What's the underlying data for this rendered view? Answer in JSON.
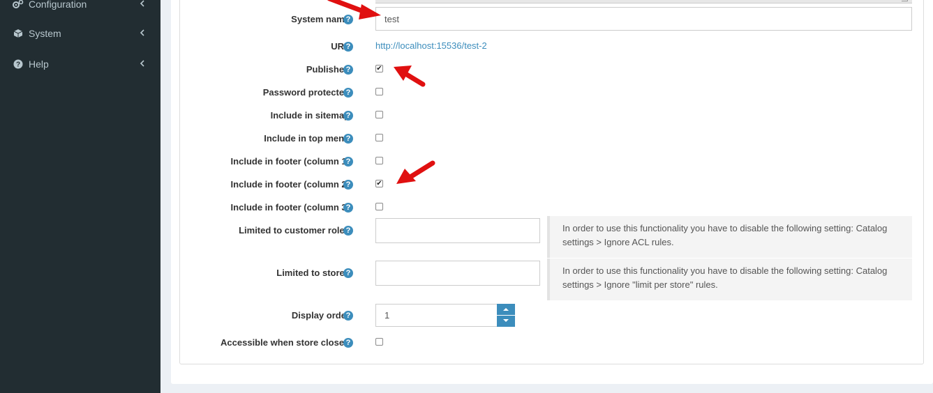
{
  "sidebar": {
    "items": [
      {
        "label": "Configuration",
        "icon": "gears-icon"
      },
      {
        "label": "System",
        "icon": "cube-icon"
      },
      {
        "label": "Help",
        "icon": "question-circle-icon"
      }
    ]
  },
  "form": {
    "system_name": {
      "label": "System name",
      "value": "test"
    },
    "url": {
      "label": "URL",
      "value": "http://localhost:15536/test-2"
    },
    "published": {
      "label": "Published",
      "checked": true
    },
    "password_protected": {
      "label": "Password protected",
      "checked": false
    },
    "include_in_sitemap": {
      "label": "Include in sitemap",
      "checked": false
    },
    "include_in_top_menu": {
      "label": "Include in top menu",
      "checked": false
    },
    "include_in_footer_1": {
      "label": "Include in footer (column 1)",
      "checked": false
    },
    "include_in_footer_2": {
      "label": "Include in footer (column 2)",
      "checked": true
    },
    "include_in_footer_3": {
      "label": "Include in footer (column 3)",
      "checked": false
    },
    "limited_to_customer_roles": {
      "label": "Limited to customer roles",
      "value": "",
      "note": "In order to use this functionality you have to disable the following setting: Catalog settings > Ignore ACL rules."
    },
    "limited_to_stores": {
      "label": "Limited to stores",
      "value": "",
      "note": "In order to use this functionality you have to disable the following setting: Catalog settings > Ignore \"limit per store\" rules."
    },
    "display_order": {
      "label": "Display order",
      "value": "1"
    },
    "accessible_when_store_closed": {
      "label": "Accessible when store closed",
      "checked": false
    }
  },
  "colors": {
    "sidebar_bg": "#222d32",
    "accent": "#3c8dbc",
    "annotation_arrow": "#e01010"
  },
  "help_glyph": "?"
}
